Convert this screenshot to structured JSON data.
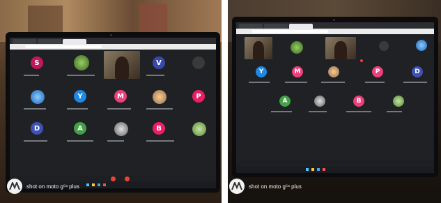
{
  "watermark": {
    "text_left": "shot on moto g⁵ˢ plus",
    "text_right": "shot on moto g⁵ˢ plus",
    "logo_icon": "motorola-logo-icon"
  },
  "left_screen": {
    "avatars": [
      {
        "letter": "S",
        "color": "#c2185b"
      },
      {
        "letter": "V",
        "color": "#3949ab"
      },
      {
        "letter": "Y",
        "color": "#1e88e5"
      },
      {
        "letter": "M",
        "color": "#ec407a"
      },
      {
        "letter": "P",
        "color": "#e91e63"
      },
      {
        "letter": "D",
        "color": "#3f51b5"
      },
      {
        "letter": "A",
        "color": "#43a047"
      },
      {
        "letter": "B",
        "color": "#e91e63"
      }
    ]
  },
  "right_screen": {
    "avatars": [
      {
        "letter": "Y",
        "color": "#1e88e5"
      },
      {
        "letter": "M",
        "color": "#ec407a"
      },
      {
        "letter": "P",
        "color": "#ec407a"
      },
      {
        "letter": "D",
        "color": "#3f51b5"
      },
      {
        "letter": "A",
        "color": "#43a047"
      },
      {
        "letter": "B",
        "color": "#ec407a"
      }
    ]
  }
}
